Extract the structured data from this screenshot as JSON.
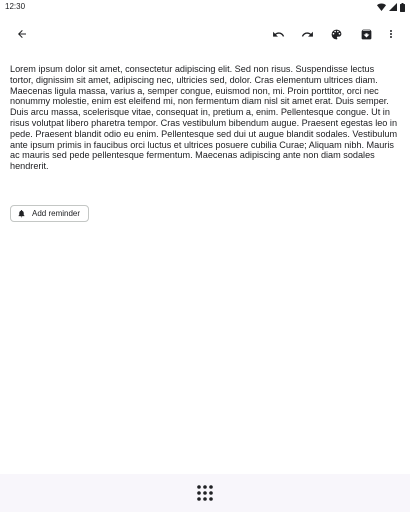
{
  "status_bar": {
    "time": "12:30",
    "icons": [
      "wifi-icon",
      "signal-icon",
      "battery-icon"
    ]
  },
  "toolbar": {
    "back_icon": "arrow-back-icon",
    "actions": [
      "undo-icon",
      "redo-icon",
      "palette-icon",
      "archive-icon",
      "more-vert-icon"
    ]
  },
  "note": {
    "body": "Lorem ipsum dolor sit amet, consectetur adipiscing elit. Sed non risus. Suspendisse lectus tortor, dignissim sit amet, adipiscing nec, ultricies sed, dolor. Cras elementum ultrices diam. Maecenas ligula massa, varius a, semper congue, euismod non, mi. Proin porttitor, orci nec nonummy molestie, enim est eleifend mi, non fermentum diam nisl sit amet erat. Duis semper. Duis arcu massa, scelerisque vitae, consequat in, pretium a, enim. Pellentesque congue. Ut in risus volutpat libero pharetra tempor. Cras vestibulum bibendum augue. Praesent egestas leo in pede. Praesent blandit odio eu enim. Pellentesque sed dui ut augue blandit sodales. Vestibulum ante ipsum primis in faucibus orci luctus et ultrices posuere cubilia Curae; Aliquam nibh. Mauris ac mauris sed pede pellentesque fermentum. Maecenas adipiscing ante non diam sodales hendrerit."
  },
  "reminder": {
    "label": "Add reminder",
    "icon": "bell-icon"
  },
  "bottom_bar": {
    "icon": "apps-grid-icon",
    "background": "#f8f6fb"
  },
  "colors": {
    "text": "#202124",
    "chip_border": "#c4c7c5"
  }
}
